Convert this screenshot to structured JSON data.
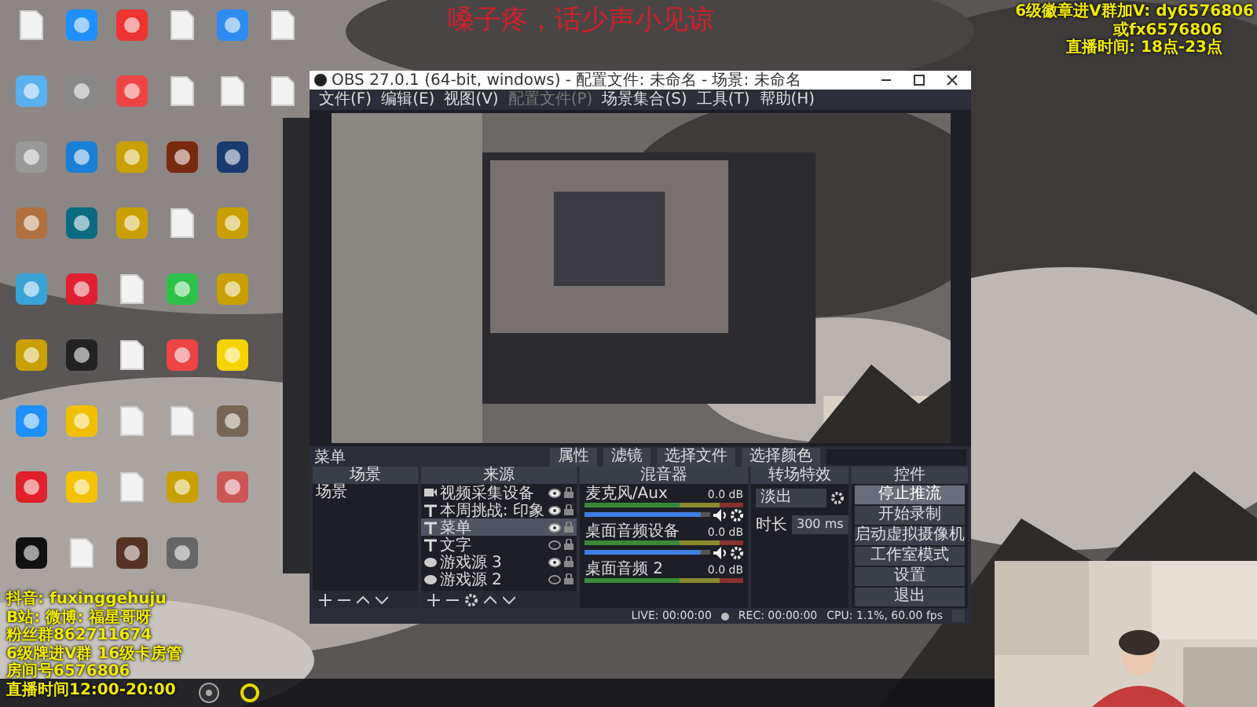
{
  "overlay_top": "嗓子疼，话少声小见谅",
  "overlay_right": [
    "6级徽章进V群加V: dy6576806",
    "或fx6576806",
    "直播时间: 18点-23点"
  ],
  "overlay_left": [
    "抖音: fuxinggehuju",
    "B站: 微博: 福星哥呀",
    "粉丝群862711674",
    "6级牌进V群 16级卡房管",
    "房间号6576806",
    "直播时间12:00-20:00"
  ],
  "obs": {
    "title": "OBS 27.0.1 (64-bit, windows) - 配置文件: 未命名 - 场景: 未命名",
    "menu": [
      {
        "label": "文件(F)",
        "disabled": false
      },
      {
        "label": "编辑(E)",
        "disabled": false
      },
      {
        "label": "视图(V)",
        "disabled": false
      },
      {
        "label": "配置文件(P)",
        "disabled": true
      },
      {
        "label": "场景集合(S)",
        "disabled": false
      },
      {
        "label": "工具(T)",
        "disabled": false
      },
      {
        "label": "帮助(H)",
        "disabled": false
      }
    ],
    "source_toolbar": {
      "label": "菜单",
      "buttons": [
        "属性",
        "滤镜",
        "选择文件",
        "选择颜色"
      ]
    },
    "scenes": {
      "title": "场景",
      "items": [
        {
          "label": "场景",
          "selected": false
        }
      ]
    },
    "sources": {
      "title": "来源",
      "items": [
        {
          "label": "视频采集设备",
          "kind": "camera",
          "visible": true,
          "selected": false
        },
        {
          "label": "本周挑战: 印象",
          "kind": "text",
          "visible": true,
          "selected": false
        },
        {
          "label": "菜单",
          "kind": "text",
          "visible": true,
          "selected": true
        },
        {
          "label": "文字",
          "kind": "text",
          "visible": false,
          "selected": false
        },
        {
          "label": "游戏源 3",
          "kind": "game",
          "visible": true,
          "selected": false
        },
        {
          "label": "游戏源 2",
          "kind": "game",
          "visible": false,
          "selected": false
        }
      ]
    },
    "mixer": {
      "title": "混音器",
      "channels": [
        {
          "name": "麦克风/Aux",
          "reading": "0.0 dB",
          "level": 0.93
        },
        {
          "name": "桌面音频设备",
          "reading": "0.0 dB",
          "level": 0.93
        },
        {
          "name": "桌面音频 2",
          "reading": "0.0 dB"
        }
      ]
    },
    "transitions": {
      "title": "转场特效",
      "type": "淡出",
      "duration_label": "时长",
      "duration": "300 ms"
    },
    "controls": {
      "title": "控件",
      "buttons": [
        {
          "label": "停止推流",
          "selected": true
        },
        {
          "label": "开始录制",
          "selected": false
        },
        {
          "label": "启动虚拟摄像机",
          "selected": false
        },
        {
          "label": "工作室模式",
          "selected": false
        },
        {
          "label": "设置",
          "selected": false
        },
        {
          "label": "退出",
          "selected": false
        }
      ]
    },
    "status": {
      "live": "LIVE: 00:00:00",
      "rec": "REC: 00:00:00",
      "cpu": "CPU: 1.1%, 60.00 fps"
    }
  }
}
